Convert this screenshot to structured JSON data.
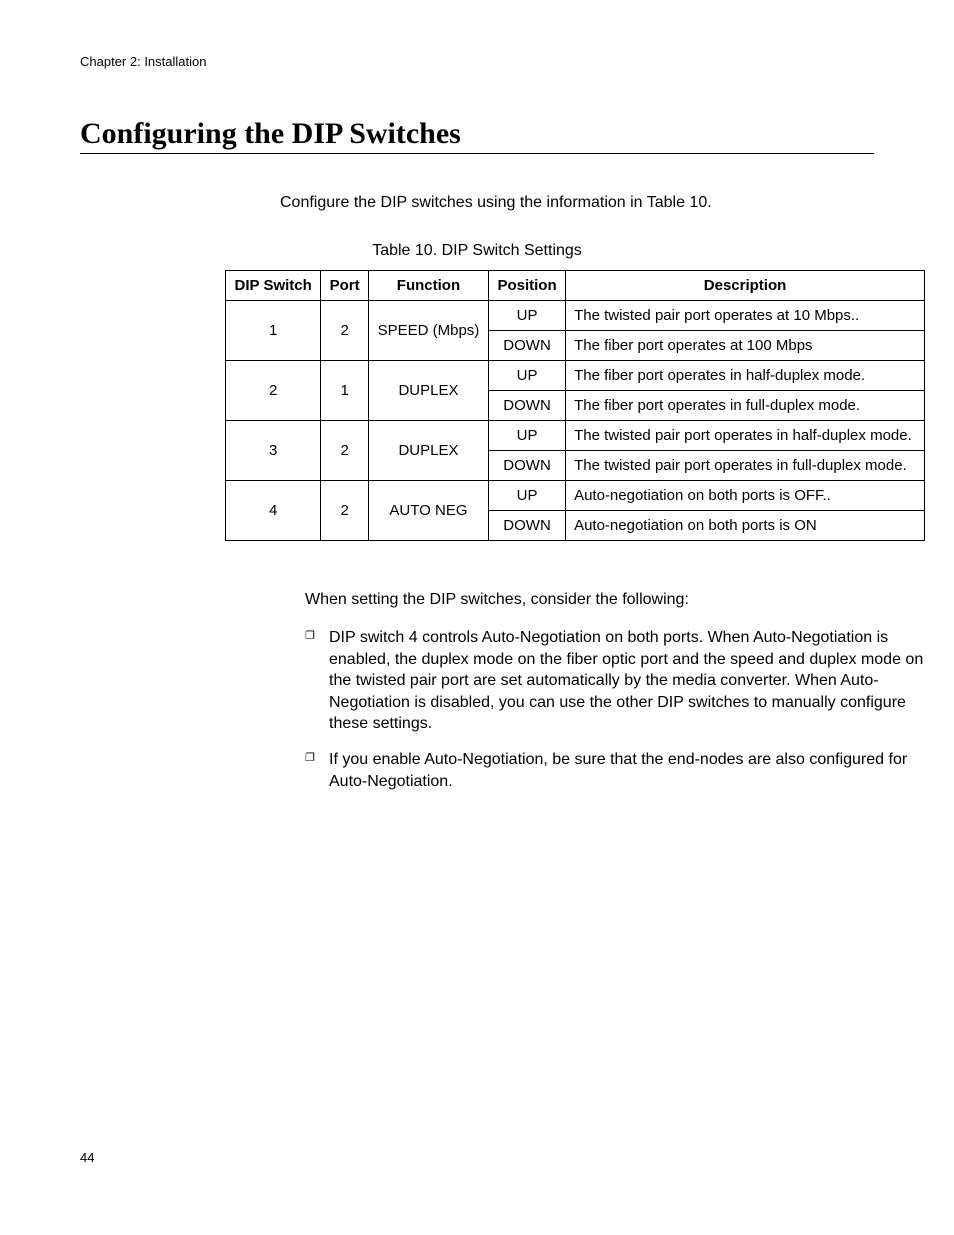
{
  "header": {
    "chapter": "Chapter 2: Installation"
  },
  "title": "Configuring the DIP Switches",
  "intro": "Configure the DIP switches using the information in Table 10.",
  "table": {
    "caption": "Table 10. DIP Switch Settings",
    "headers": {
      "dip": "DIP Switch",
      "port": "Port",
      "func": "Function",
      "pos": "Position",
      "desc": "Description"
    },
    "rows": [
      {
        "dip": "1",
        "port": "2",
        "func": "SPEED (Mbps)",
        "pos": "UP",
        "desc": "The twisted pair port operates at 10 Mbps.."
      },
      {
        "pos": "DOWN",
        "desc": "The fiber port operates at 100 Mbps"
      },
      {
        "dip": "2",
        "port": "1",
        "func": "DUPLEX",
        "pos": "UP",
        "desc": "The fiber port operates in half-duplex mode."
      },
      {
        "pos": "DOWN",
        "desc": "The fiber port operates in full-duplex mode."
      },
      {
        "dip": "3",
        "port": "2",
        "func": "DUPLEX",
        "pos": "UP",
        "desc": "The twisted pair port operates in half-duplex mode."
      },
      {
        "pos": "DOWN",
        "desc": "The twisted pair port operates in full-duplex mode."
      },
      {
        "dip": "4",
        "port": "2",
        "func": "AUTO NEG",
        "pos": "UP",
        "desc": "Auto-negotiation on both ports is OFF.."
      },
      {
        "pos": "DOWN",
        "desc": "Auto-negotiation on both ports is ON"
      }
    ]
  },
  "after": {
    "lead": "When setting the DIP switches, consider the following:",
    "bullets": [
      "DIP switch 4 controls Auto-Negotiation on both ports. When Auto-Negotiation is enabled, the duplex mode on the fiber optic port and the speed and duplex mode on the twisted pair port are set automatically by the media converter. When Auto-Negotiation is disabled, you can use the other DIP switches to manually configure these settings.",
      "If you enable Auto-Negotiation, be sure that the end-nodes are also configured for Auto-Negotiation."
    ]
  },
  "pageNumber": "44"
}
